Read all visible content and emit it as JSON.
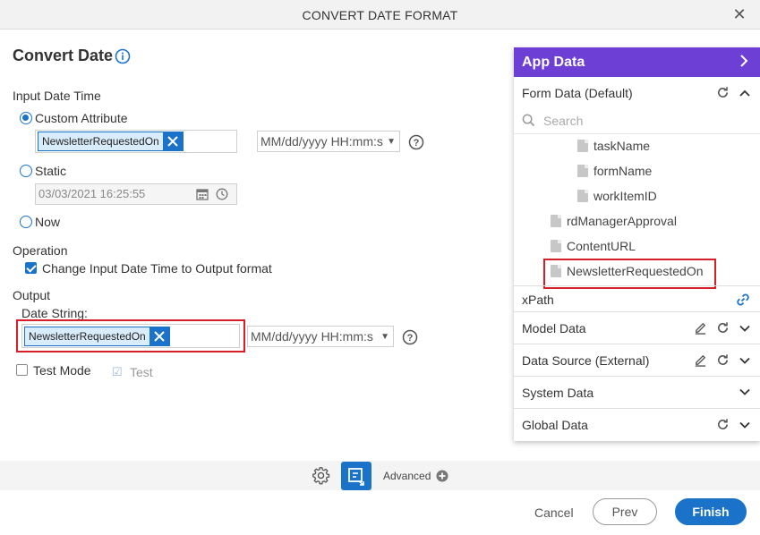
{
  "dialog": {
    "title": "CONVERT DATE FORMAT"
  },
  "main": {
    "heading": "Convert Date",
    "input_date_time": {
      "label": "Input Date Time",
      "custom_attribute": {
        "label": "Custom Attribute",
        "chip": "NewsletterRequestedOn",
        "format": "MM/dd/yyyy HH:mm:s"
      },
      "static": {
        "label": "Static",
        "value": "03/03/2021 16:25:55"
      },
      "now": {
        "label": "Now"
      }
    },
    "operation": {
      "label": "Operation",
      "checkbox_label": "Change Input Date Time to Output format"
    },
    "output": {
      "label": "Output",
      "date_string_label": "Date String:",
      "chip": "NewsletterRequestedOn",
      "format": "MM/dd/yyyy HH:mm:s"
    },
    "test_mode_label": "Test Mode",
    "test_label": "Test"
  },
  "toolbar": {
    "advanced_label": "Advanced"
  },
  "footer": {
    "cancel": "Cancel",
    "prev": "Prev",
    "finish": "Finish"
  },
  "app_data": {
    "title": "App Data",
    "form_data": "Form Data (Default)",
    "search_placeholder": "Search",
    "tree": [
      "taskName",
      "formName",
      "workItemID",
      "rdManagerApproval",
      "ContentURL",
      "NewsletterRequestedOn"
    ],
    "xpath": "xPath",
    "model_data": "Model Data",
    "data_source": "Data Source (External)",
    "system_data": "System Data",
    "global_data": "Global Data"
  },
  "colors": {
    "accent": "#1a73c9",
    "panel_header": "#6d3fd4",
    "highlight": "#d61f26"
  }
}
